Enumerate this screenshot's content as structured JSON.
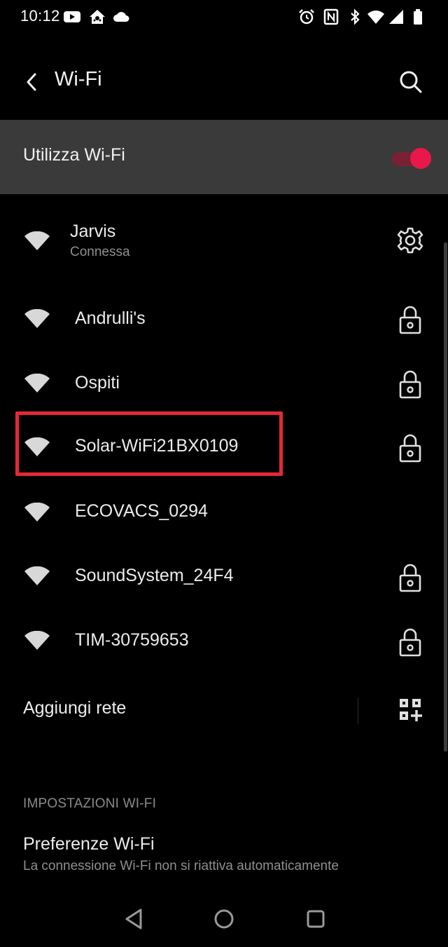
{
  "status_bar": {
    "time": "10:12",
    "left_icons": [
      "youtube-icon",
      "home-assistant-icon",
      "cloud-icon"
    ],
    "right_icons": [
      "alarm-icon",
      "nfc-icon",
      "bluetooth-icon",
      "wifi-signal-icon",
      "cell-signal-icon",
      "battery-icon"
    ]
  },
  "header": {
    "title": "Wi-Fi",
    "back_icon": "chevron-left-icon",
    "search_icon": "search-icon"
  },
  "master_toggle": {
    "label": "Utilizza Wi-Fi",
    "enabled": true,
    "accent_color": "#e8184a"
  },
  "networks": [
    {
      "name": "Jarvis",
      "status": "Connessa",
      "trailing_icon": "gear-icon"
    },
    {
      "name": "Andrulli's",
      "trailing_icon": "lock-icon"
    },
    {
      "name": "Ospiti",
      "trailing_icon": "lock-icon"
    },
    {
      "name": "Solar-WiFi21BX0109",
      "trailing_icon": "lock-icon",
      "highlighted": true
    },
    {
      "name": "ECOVACS_0294",
      "trailing_icon": null
    },
    {
      "name": "SoundSystem_24F4",
      "trailing_icon": "lock-icon"
    },
    {
      "name": "TIM-30759653",
      "trailing_icon": "lock-icon"
    }
  ],
  "add_network": {
    "label": "Aggiungi rete",
    "icon": "qr-code-add-icon"
  },
  "settings_section": {
    "header": "IMPOSTAZIONI WI-FI",
    "items": [
      {
        "title": "Preferenze Wi-Fi",
        "subtitle": "La connessione Wi-Fi non si riattiva automaticamente"
      }
    ]
  },
  "highlight_color": "#e52837",
  "nav_bar": [
    "back-triangle-icon",
    "home-circle-icon",
    "recents-square-icon"
  ]
}
